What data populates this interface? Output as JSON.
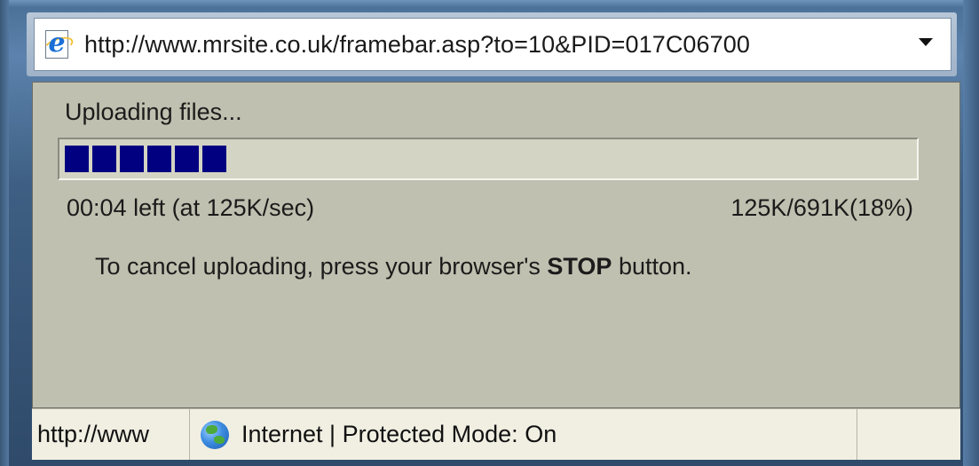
{
  "address_bar": {
    "url": "http://www.mrsite.co.uk/framebar.asp?to=10&PID=017C06700"
  },
  "upload": {
    "title": "Uploading files...",
    "progress_percent": 18,
    "progress_blocks": 6,
    "time_left": "00:04 left (at 125K/sec)",
    "size_info": "125K/691K(18%)",
    "cancel_prefix": "To cancel uploading, press your browser's ",
    "cancel_bold": "STOP",
    "cancel_suffix": " button."
  },
  "status_bar": {
    "url": "http://www",
    "zone": "Internet | Protected Mode: On"
  },
  "colors": {
    "progress_fill": "#000080",
    "content_bg": "#c0c0b0"
  },
  "icons": {
    "page_icon": "internet-explorer-icon",
    "dropdown": "chevron-down-icon",
    "zone": "globe-icon"
  }
}
